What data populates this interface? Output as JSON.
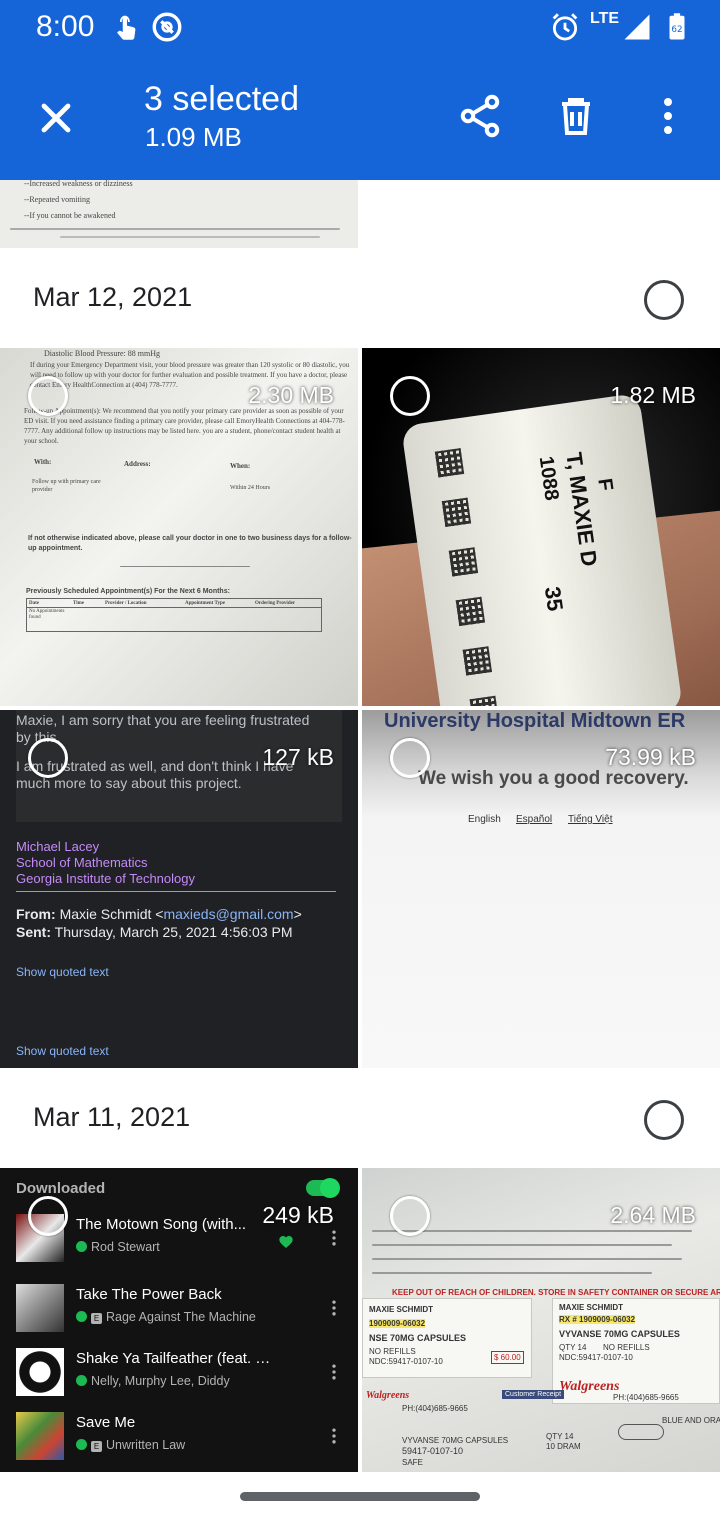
{
  "status_bar": {
    "time": "8:00",
    "network": "LTE",
    "battery_level": "62",
    "icons": [
      "touch-icon",
      "assistant-icon",
      "alarm-icon",
      "signal-icon",
      "battery-icon"
    ]
  },
  "app_bar": {
    "selection_title": "3 selected",
    "selection_size": "1.09 MB",
    "close_icon": "close-icon",
    "share_icon": "share-icon",
    "delete_icon": "delete-icon",
    "more_icon": "more-vert-icon",
    "accent": "#1565d8"
  },
  "groups": [
    {
      "date": "Mar 12, 2021",
      "photos": [
        {
          "size": "2.30 MB"
        },
        {
          "size": "1.82 MB"
        },
        {
          "size": "127 kB"
        },
        {
          "size": "73.99 kB"
        }
      ]
    },
    {
      "date": "Mar 11, 2021",
      "photos": [
        {
          "size": "249 kB"
        },
        {
          "size": "2.64 MB"
        }
      ]
    }
  ],
  "doc_top": {
    "lines": [
      "--Increased weakness or dizziness",
      "--Repeated vomiting",
      "--If you cannot be awakened"
    ]
  },
  "doc_1": {
    "lines": [
      "Diastolic Blood Pressure: 88 mmHg",
      "If during your Emergency Department visit, your blood pressure was greater than 120 systolic or 80",
      "diastolic, you will need to follow up with your doctor for further evaluation and possible treatment. If you",
      "have a doctor, please contact Emory HealthConnection at (404) 778-7777.",
      "Follow-up Appointment(s): We recommend that you notify your primary care provider as soon as",
      "possible of your ED visit. If you need assistance finding a primary care provider, please call",
      "EmoryHealth Connections at 404-778-7777. Any additional follow up instructions may be listed here.",
      "you are a student, phone/contact student health at your school."
    ],
    "table_head": [
      "With:",
      "Address:",
      "When:"
    ],
    "follow_row": [
      "Follow up with primary care provider",
      "Within 24 Hours"
    ],
    "note": "If not otherwise indicated above, please call your doctor in one to two business days for a follow-up appointment.",
    "sched_title": "Previously Scheduled Appointment(s) For the Next 6 Months:",
    "sched_cols": [
      "Date",
      "Time",
      "Provider / Location",
      "Appointment Type",
      "Ordering Provider"
    ],
    "sched_empty": "No Appointments found"
  },
  "wristband": {
    "lines": [
      "1088",
      "T, MAXIE D",
      "F",
      "35"
    ]
  },
  "email": {
    "quote_line1": "Maxie, I am sorry that you are feeling frustrated by this.",
    "quote_line2": "I am frustrated as well, and don't think I have much more to say about this project.",
    "sig_name": "Michael Lacey",
    "sig_school": "School of Mathematics",
    "sig_inst": "Georgia Institute of Technology",
    "from_label": "From:",
    "from_name": "Maxie Schmidt <",
    "from_email": "maxieds@gmail.com",
    "from_end": ">",
    "sent_label": "Sent:",
    "sent_value": "Thursday, March 25, 2021 4:56:03 PM",
    "show_quoted_1": "Show quoted text",
    "show_quoted_2": "Show quoted text"
  },
  "web": {
    "title": "University Hospital Midtown ER",
    "subtitle": "We wish you a good recovery.",
    "lang_1": "English",
    "lang_2": "Español",
    "lang_3": "Tiếng Việt"
  },
  "spotify": {
    "header": "Downloaded",
    "tracks": [
      {
        "title": "The Motown Song (with...",
        "artist": "Rod Stewart",
        "explicit": false,
        "liked": true
      },
      {
        "title": "Take The Power Back",
        "artist": "Rage Against The Machine",
        "explicit": true,
        "liked": false
      },
      {
        "title": "Shake Ya Tailfeather (feat. P. D...",
        "artist": "Nelly, Murphy Lee, Diddy",
        "explicit": false,
        "liked": false
      },
      {
        "title": "Save Me",
        "artist": "Unwritten Law",
        "explicit": true,
        "liked": false
      }
    ],
    "explicit_badge": "E",
    "accent": "#1db954"
  },
  "receipt": {
    "name": "MAXIE SCHMIDT",
    "rx": "RX # 1909009-06032",
    "rx_short": "1909009-06032",
    "drug": "VYVANSE 70MG CAPSULES",
    "drug_short": "NSE 70MG CAPSULES",
    "qty": "QTY 14",
    "refills": "NO REFILLS",
    "ndc": "NDC:59417-0107-10",
    "price": "$ 60.00",
    "store": "Walgreens",
    "phone": "PH:(404)685-9665",
    "warning": "KEEP OUT OF REACH OF CHILDREN. STORE IN SAFETY CONTAINER OR SECURE AREA.",
    "bottom_drug": "VYVANSE 70MG CAPSULES",
    "bottom_ndc": "59417-0107-10",
    "bottom_safe": "SAFE",
    "bottom_qty": "QTY 14",
    "bottom_dram": "10 DRAM",
    "customer_receipt": "Customer Receipt",
    "blue_orange": "BLUE AND ORAN"
  }
}
